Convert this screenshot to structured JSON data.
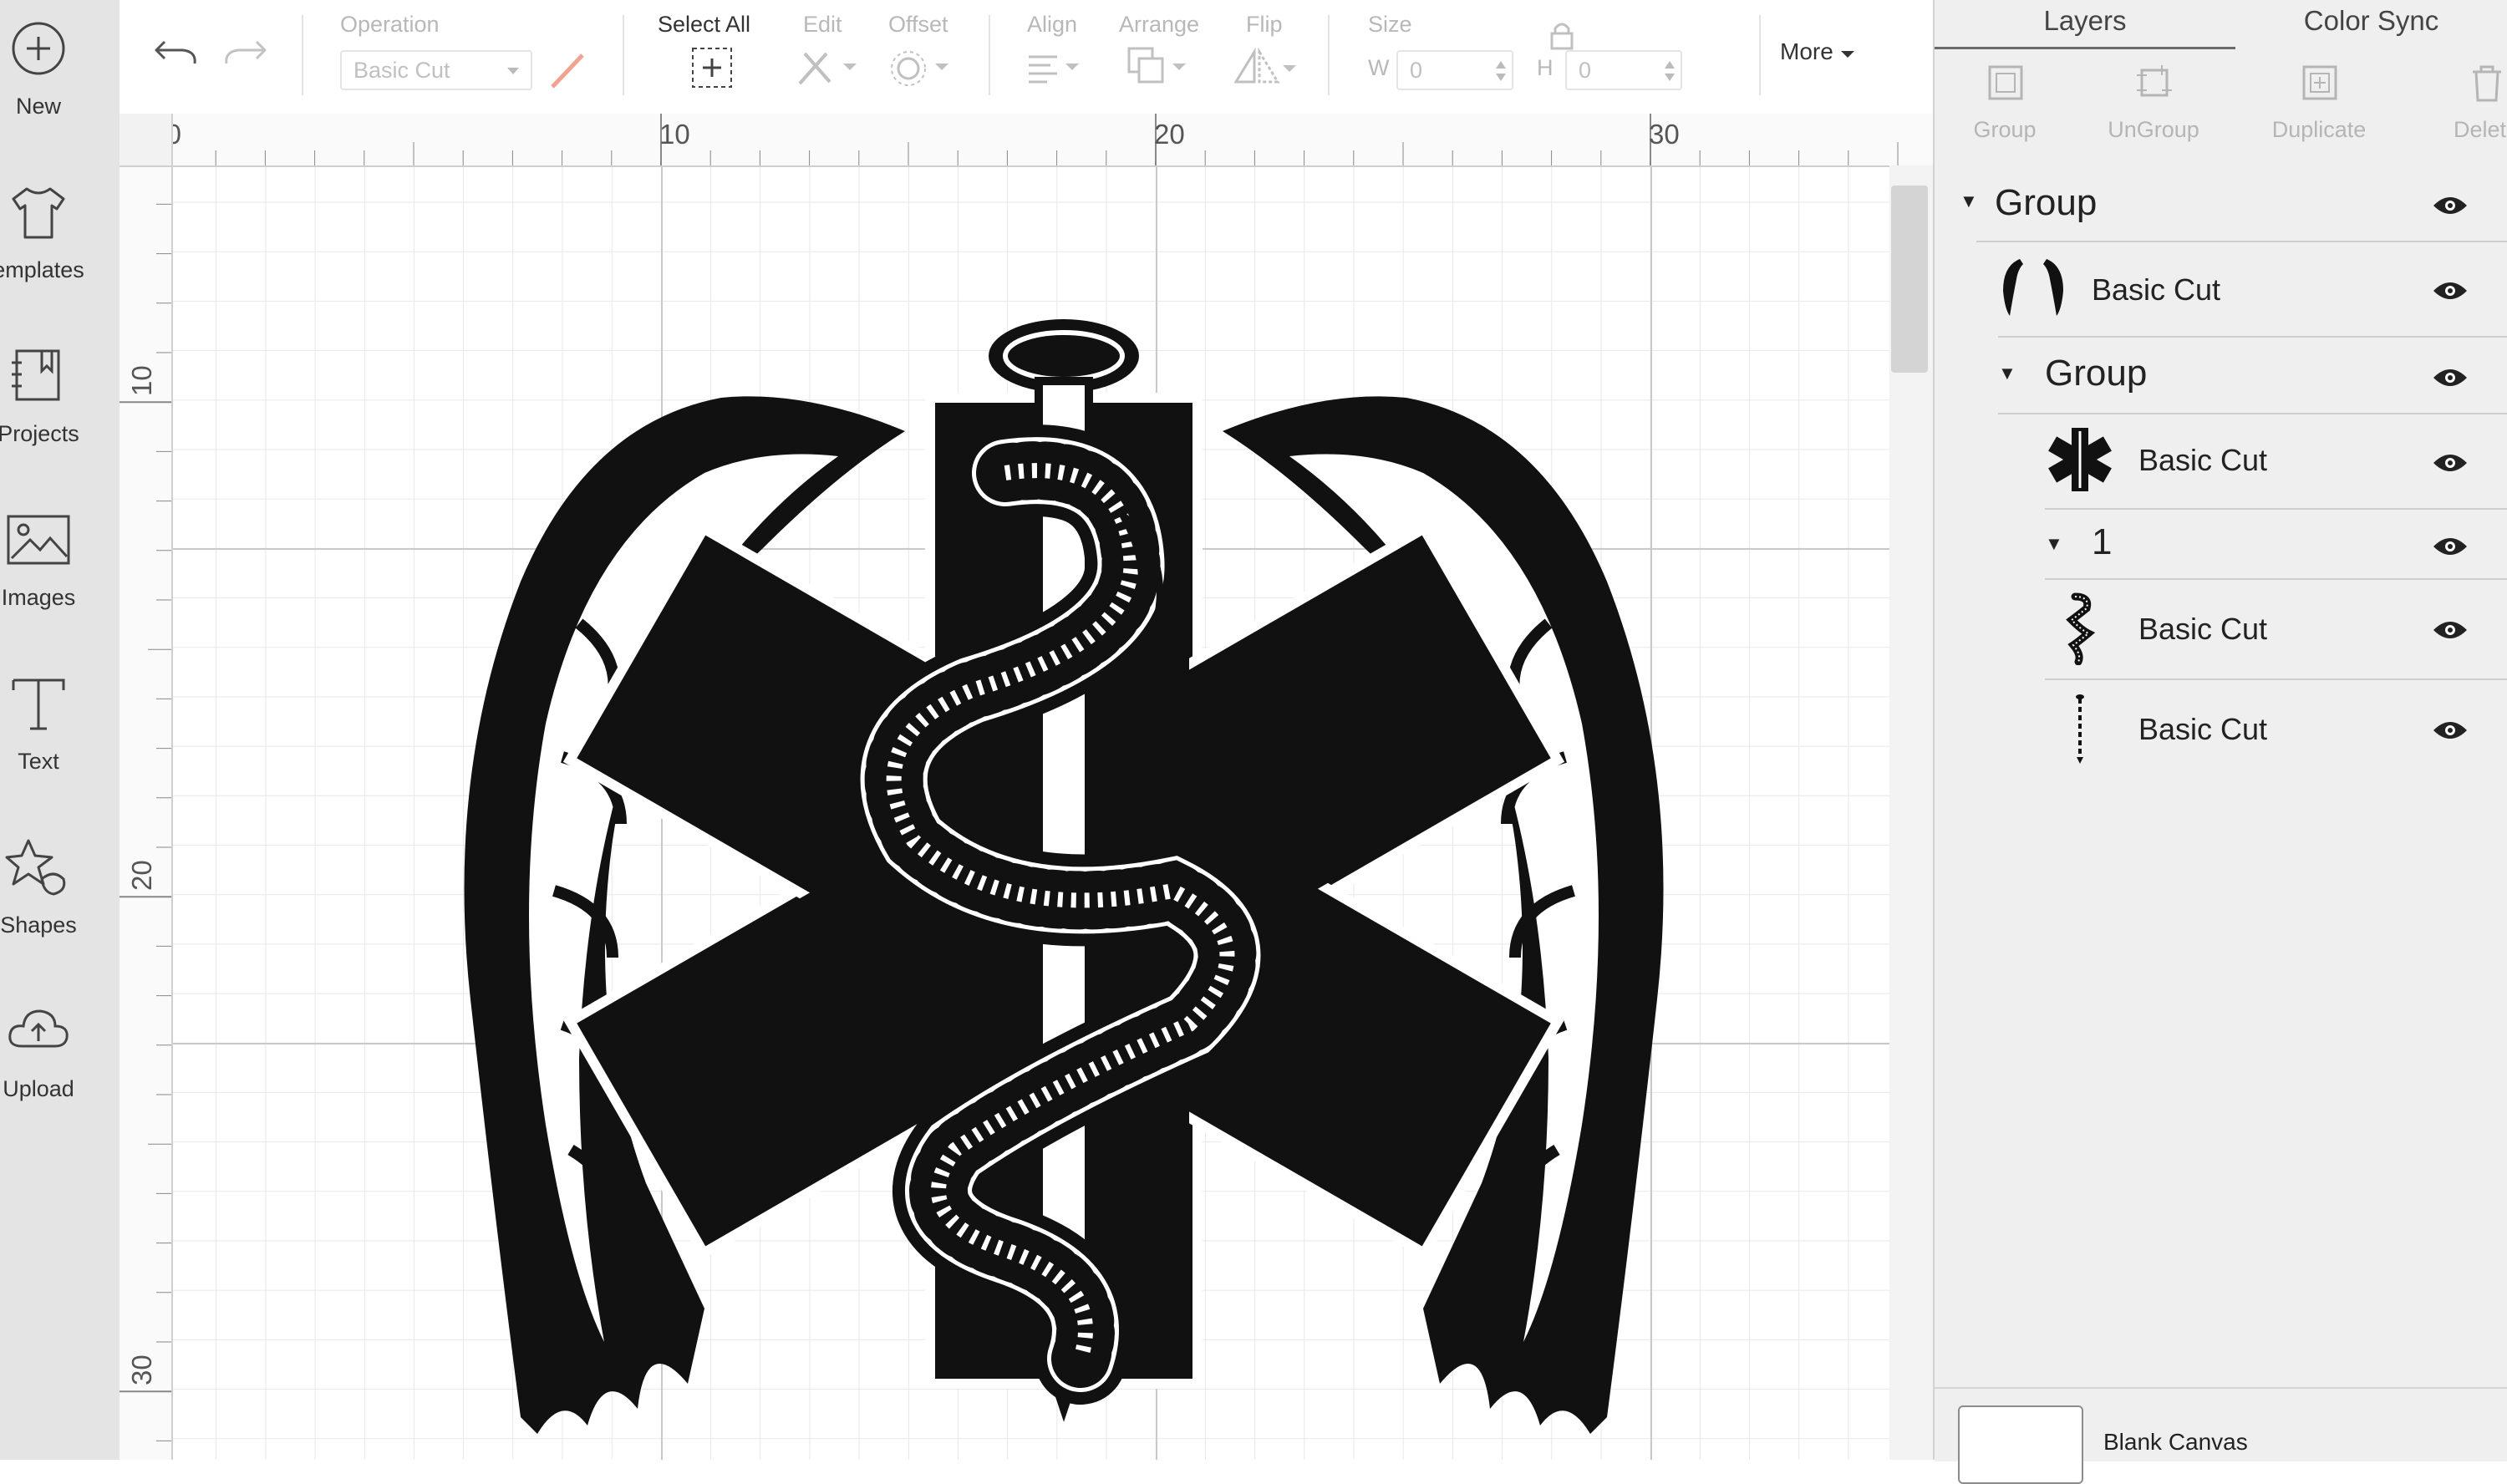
{
  "sidebar": {
    "items": [
      {
        "label": "New",
        "icon": "plus-circle-icon"
      },
      {
        "label": "emplates",
        "icon": "tshirt-icon"
      },
      {
        "label": "Projects",
        "icon": "bookmark-book-icon"
      },
      {
        "label": "Images",
        "icon": "image-icon"
      },
      {
        "label": "Text",
        "icon": "text-t-icon"
      },
      {
        "label": "Shapes",
        "icon": "shapes-icon"
      },
      {
        "label": "Upload",
        "icon": "cloud-upload-icon"
      }
    ]
  },
  "toolbar": {
    "undo_icon": "undo-arrow-icon",
    "redo_icon": "redo-arrow-icon",
    "operation_label": "Operation",
    "operation_value": "Basic Cut",
    "select_all_label": "Select All",
    "edit_label": "Edit",
    "offset_label": "Offset",
    "align_label": "Align",
    "arrange_label": "Arrange",
    "flip_label": "Flip",
    "size_label": "Size",
    "w_label": "W",
    "w_value": "0",
    "h_label": "H",
    "h_value": "0",
    "more_label": "More"
  },
  "canvas": {
    "ruler_top": [
      "0",
      "10",
      "20",
      "30"
    ],
    "ruler_left": [
      "10",
      "20",
      "30"
    ],
    "artwork": "Star of Life emblem with snake entwined staff and angel wings"
  },
  "panel": {
    "tabs": [
      "Layers",
      "Color Sync"
    ],
    "actions": [
      "Group",
      "UnGroup",
      "Duplicate",
      "Delete"
    ],
    "layers": [
      {
        "name": "Group",
        "level": 0,
        "type": "group"
      },
      {
        "name": "Basic Cut",
        "level": 1,
        "type": "layer",
        "thumb": "wings-thumbnail"
      },
      {
        "name": "Group",
        "level": 1,
        "type": "group"
      },
      {
        "name": "Basic Cut",
        "level": 2,
        "type": "layer",
        "thumb": "star-of-life-thumbnail"
      },
      {
        "name": "1",
        "level": 2,
        "type": "group"
      },
      {
        "name": "Basic Cut",
        "level": 3,
        "type": "layer",
        "thumb": "snake-thumbnail"
      },
      {
        "name": "Basic Cut",
        "level": 3,
        "type": "layer",
        "thumb": "staff-thumbnail"
      }
    ],
    "blank_canvas_label": "Blank Canvas"
  },
  "colors": {
    "sidebar_bg": "#e4e4e4",
    "panel_bg": "#efefef",
    "art": "#111111"
  }
}
